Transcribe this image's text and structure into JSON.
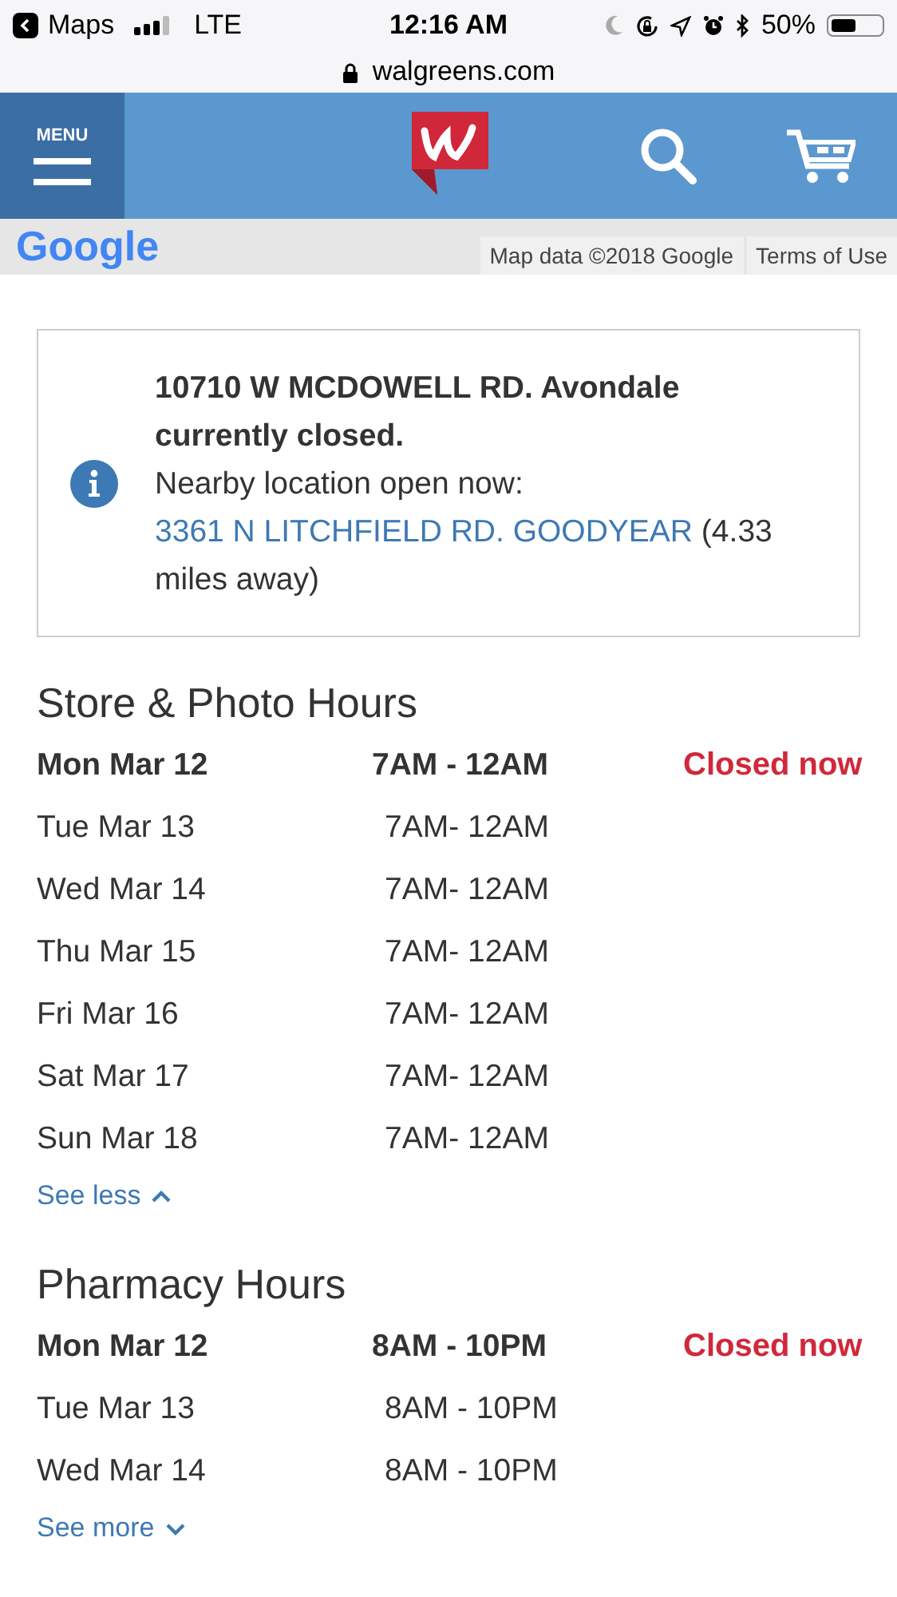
{
  "status_bar": {
    "back_app": "Maps",
    "network": "LTE",
    "time": "12:16 AM",
    "battery": "50%"
  },
  "address_bar": {
    "url": "walgreens.com"
  },
  "header": {
    "menu_label": "MENU"
  },
  "map": {
    "logo": "Google",
    "attribution": "Map data ©2018 Google",
    "terms": "Terms of Use"
  },
  "notice": {
    "title": "10710 W MCDOWELL RD. Avondale currently closed.",
    "text": "Nearby location open now:",
    "link": "3361 N LITCHFIELD RD. GOODYEAR",
    "after_link": "(4.33 miles away)"
  },
  "sections": [
    {
      "title": "Store & Photo Hours",
      "rows": [
        {
          "day": "Mon Mar 12",
          "hours": "7AM - 12AM",
          "today": true,
          "status": "Closed now"
        },
        {
          "day": "Tue Mar 13",
          "hours": "7AM- 12AM",
          "today": false
        },
        {
          "day": "Wed Mar 14",
          "hours": "7AM- 12AM",
          "today": false
        },
        {
          "day": "Thu Mar 15",
          "hours": "7AM- 12AM",
          "today": false
        },
        {
          "day": "Fri Mar 16",
          "hours": "7AM- 12AM",
          "today": false
        },
        {
          "day": "Sat Mar 17",
          "hours": "7AM- 12AM",
          "today": false
        },
        {
          "day": "Sun Mar 18",
          "hours": "7AM- 12AM",
          "today": false
        }
      ],
      "toggle": {
        "label": "See less",
        "expanded": true
      }
    },
    {
      "title": "Pharmacy Hours",
      "rows": [
        {
          "day": "Mon Mar 12",
          "hours": "8AM - 10PM",
          "today": true,
          "status": "Closed now"
        },
        {
          "day": "Tue Mar 13",
          "hours": "8AM - 10PM",
          "today": false
        },
        {
          "day": "Wed Mar 14",
          "hours": "8AM - 10PM",
          "today": false
        }
      ],
      "toggle": {
        "label": "See more",
        "expanded": false
      }
    }
  ]
}
